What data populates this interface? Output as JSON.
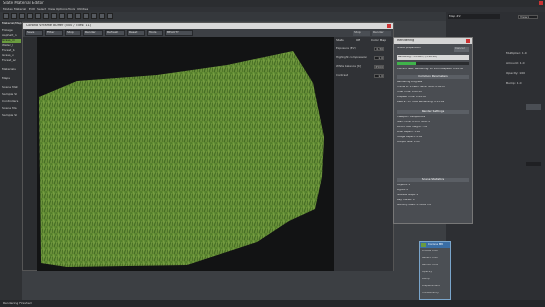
{
  "app": {
    "title": "Slate Material Editor"
  },
  "menu": [
    "Modes",
    "Material",
    "Edit",
    "Select",
    "View",
    "Options",
    "Tools",
    "Utilities"
  ],
  "left_panel": {
    "header": "Material/Map",
    "items": [
      "Foliage",
      "Asphalt_n",
      "Grass_m",
      "Water_l",
      "Forest_b",
      "Grass_v",
      "Forest_ac",
      "Materials",
      "Maps",
      "Scene Mat",
      "Sample Sl",
      "Controllers",
      "Scene Ma",
      "Sample Sl"
    ]
  },
  "frame_buffer": {
    "title": "Corona VFrame Buffer (500 / Tiles: 11)",
    "toolbar": [
      "Save",
      "Filter",
      "Stop",
      "Render",
      "Refresh",
      "Reset",
      "Tools",
      "BEAUTY"
    ],
    "side_tabs": [
      "Stats",
      "Off",
      "Color Map"
    ],
    "controls": [
      {
        "label": "Exposure (EV)",
        "value": "0.30"
      },
      {
        "label": "Highlight compression",
        "value": "1.0"
      },
      {
        "label": "White balance [K]",
        "value": "6500"
      },
      {
        "label": "Contrast",
        "value": "1.0"
      }
    ],
    "stop_label": "Stop",
    "render_label": "Render"
  },
  "render_dialog": {
    "title": "Rendering",
    "pass_label": "Scene preparation",
    "cancel": "Cancel",
    "progress_text": "Rendering - 1h:40m / (1:00:00)",
    "progress": 0.27,
    "current_task": "Current Task: Rendering: 1h 2min elapsed: 0:09:50",
    "sections": [
      {
        "title": "Common Parameters",
        "lines": [
          "Rendering Progress",
          "Frame #: 0   Last Frame Time: 0:00:07",
          "Total Time: 0:00:50",
          "Elapsed Time: 0:09:50",
          "Pass #: 11   Time Remaining: 0:15:09"
        ]
      },
      {
        "title": "Render Settings",
        "lines": [
          "Viewport: Perspective",
          "Start Time: 0   End Time: 0",
          "Width: 600   Height: 750",
          "Pixel Aspect: 1.00",
          "Image Aspect: 0.80",
          "Output Size: 1.00"
        ]
      },
      {
        "title": "Scene Statistics",
        "lines": [
          "Objects: 4",
          "Lights: 0",
          "Shadow Maps: 0",
          "Ray Traced: 0",
          "Memory Used: P:356M V:0"
        ]
      }
    ]
  },
  "node": {
    "title": "Corona Mtl",
    "slots": [
      "Diffuse color",
      "Reflect color",
      "Refract color",
      "Opacity",
      "Bump",
      "Displacement",
      "Translucency"
    ]
  },
  "right_panel": {
    "header": "Map #2",
    "fields": [
      "View1",
      "Multiplier: 1.0",
      "Amount: 1.0",
      "Opacity: 100",
      "Bump: 1.0"
    ]
  },
  "status": {
    "left": "Rendering Finished"
  }
}
